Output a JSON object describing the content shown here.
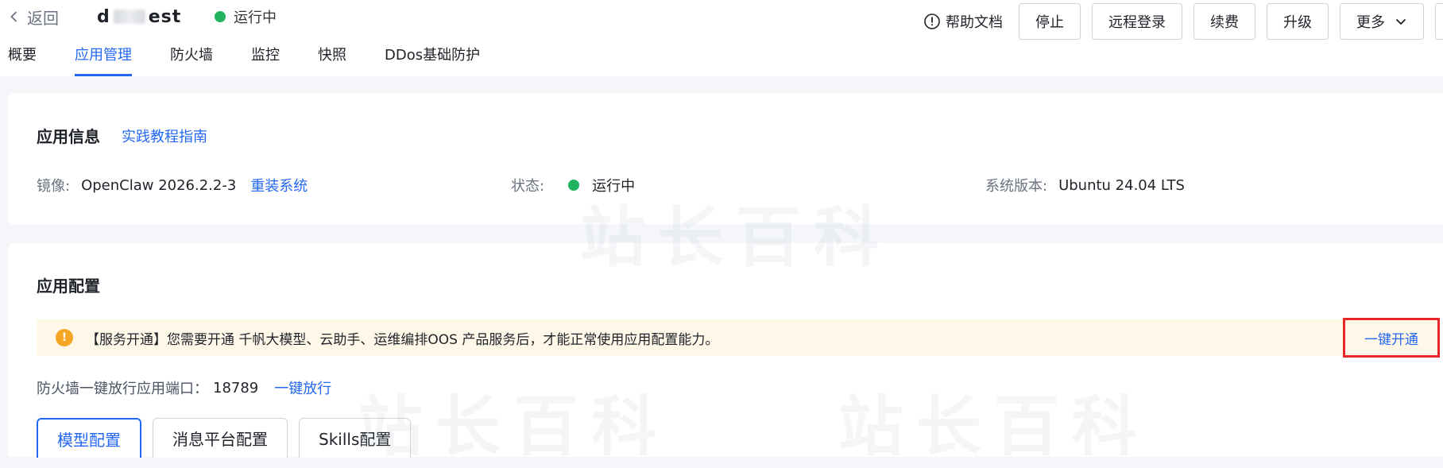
{
  "header": {
    "back_label": "返回",
    "instance_name_prefix": "d",
    "instance_name_suffix": "est",
    "status": "运行中",
    "status_color": "#22b35e",
    "help_label": "帮助文档",
    "buttons": {
      "stop": "停止",
      "remote_login": "远程登录",
      "renew": "续费",
      "upgrade": "升级",
      "more": "更多"
    }
  },
  "tabs": [
    {
      "label": "概要"
    },
    {
      "label": "应用管理",
      "active": true
    },
    {
      "label": "防火墙"
    },
    {
      "label": "监控"
    },
    {
      "label": "快照"
    },
    {
      "label": "DDos基础防护"
    }
  ],
  "app_info": {
    "title": "应用信息",
    "guide_link": "实践教程指南",
    "image_label": "镜像:",
    "image_value": "OpenClaw 2026.2.2-3",
    "reinstall_link": "重装系统",
    "status_label": "状态:",
    "status_value": "运行中",
    "os_label": "系统版本:",
    "os_value": "Ubuntu 24.04 LTS"
  },
  "app_config": {
    "title": "应用配置",
    "alert_text": "【服务开通】您需要开通 千帆大模型、云助手、运维编排OOS 产品服务后，才能正常使用应用配置能力。",
    "alert_action": "一键开通",
    "firewall_label": "防火墙一键放行应用端口：",
    "firewall_port": "18789",
    "firewall_action": "一键放行",
    "subtabs": [
      {
        "label": "模型配置",
        "active": true
      },
      {
        "label": "消息平台配置"
      },
      {
        "label": "Skills配置"
      }
    ]
  },
  "watermark": "站长百科",
  "colors": {
    "accent": "#2468f2",
    "warning": "#f5a623",
    "highlight": "#e8272b"
  },
  "icons": [
    "chevron-left-icon",
    "alert-circle-icon",
    "chevron-down-icon",
    "warning-icon"
  ]
}
